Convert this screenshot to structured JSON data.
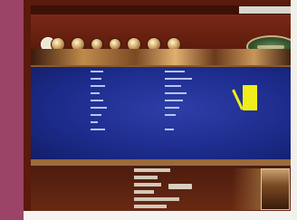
{
  "menu": {
    "items": [
      "",
      "",
      ""
    ],
    "right_tab": ""
  },
  "header": {
    "home_label": "",
    "icons": [
      "home-icon",
      "globe-icon",
      "book-icon",
      "flag-icon",
      "trophy-icon",
      "map-icon",
      "star-icon",
      "user-icon"
    ]
  },
  "stats": {
    "rows": [
      {
        "key": "",
        "value": ""
      },
      {
        "key": "",
        "value": ""
      },
      {
        "key": "",
        "value": ""
      },
      {
        "key": "",
        "value": ""
      },
      {
        "key": "",
        "value": ""
      },
      {
        "key": "",
        "value": ""
      },
      {
        "key": "",
        "value": ""
      },
      {
        "key": "",
        "value": ""
      },
      {
        "key": "",
        "value": ""
      }
    ]
  },
  "form": {
    "rows": [
      {
        "label": ""
      },
      {
        "label": ""
      },
      {
        "label": ""
      },
      {
        "label": ""
      },
      {
        "label": ""
      },
      {
        "label": ""
      }
    ],
    "submit_label": ""
  },
  "colors": {
    "frame": "#5a1a0c",
    "panel": "#1c2b8a",
    "accent": "#f0ee1a",
    "sidebar": "#9c4468"
  }
}
